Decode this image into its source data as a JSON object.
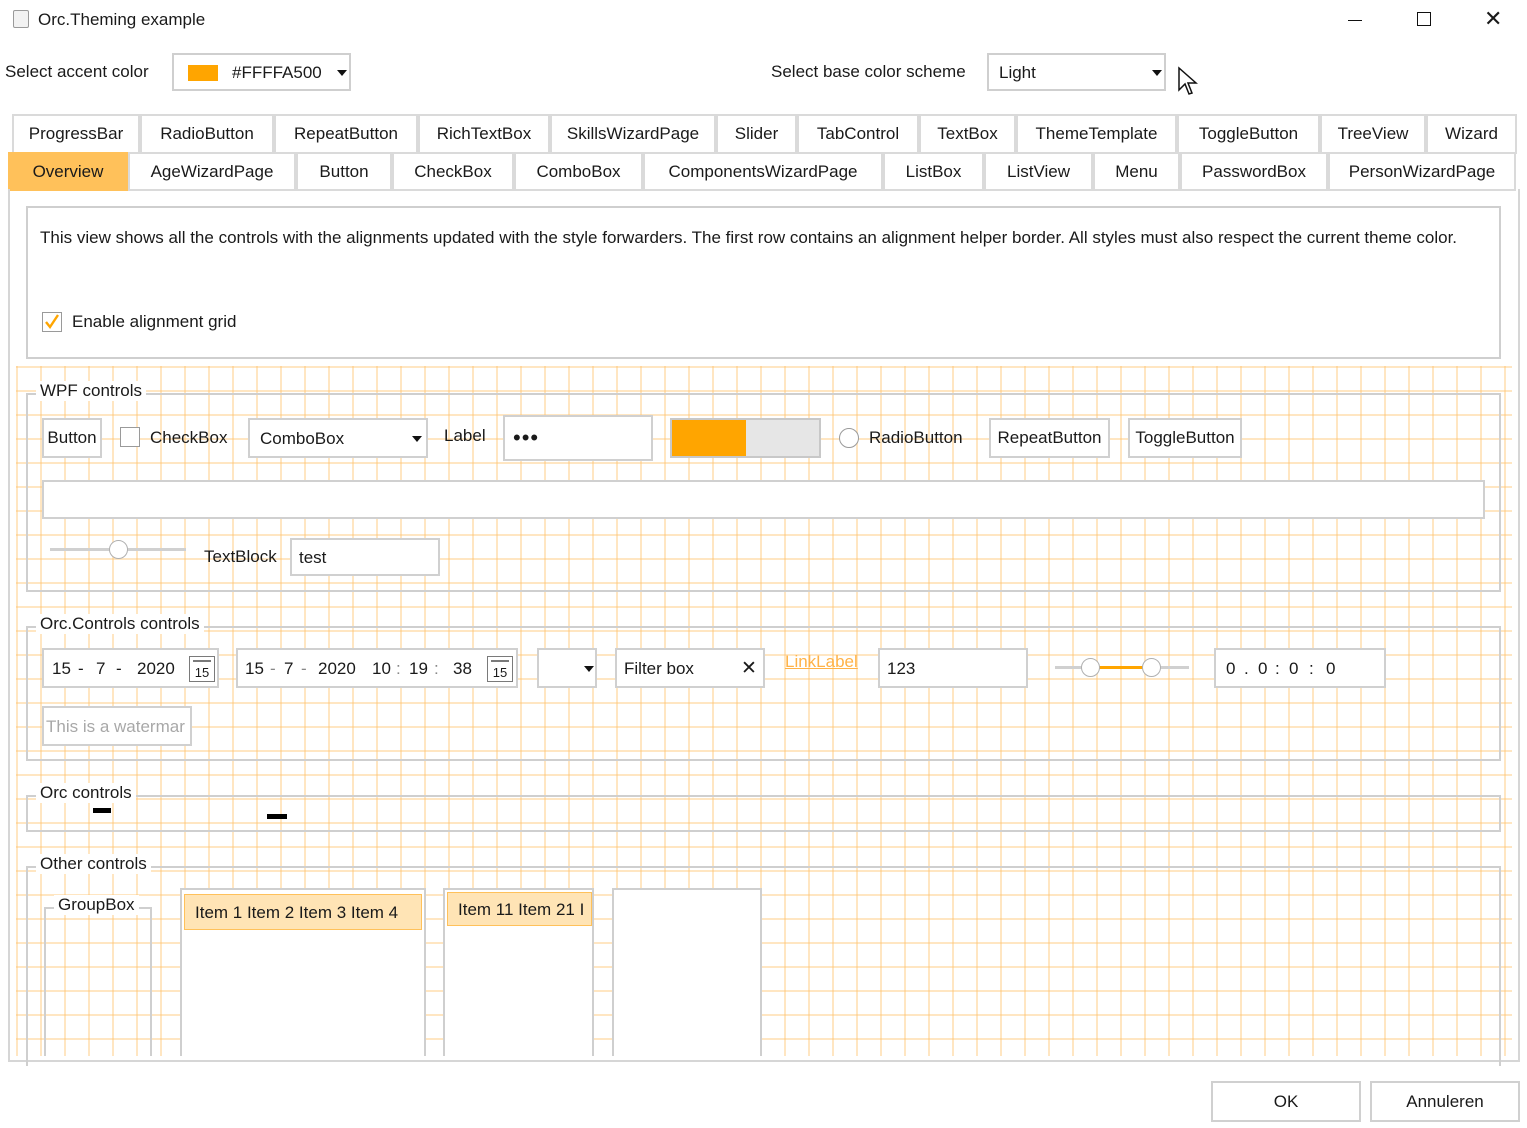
{
  "window": {
    "title": "Orc.Theming example"
  },
  "header": {
    "accent_label": "Select accent color",
    "accent_value": "#FFFFA500",
    "accent_color": "#FFA500",
    "scheme_label": "Select base color scheme",
    "scheme_value": "Light"
  },
  "tabs_row1": [
    "ProgressBar",
    "RadioButton",
    "RepeatButton",
    "RichTextBox",
    "SkillsWizardPage",
    "Slider",
    "TabControl",
    "TextBox",
    "ThemeTemplate",
    "ToggleButton",
    "TreeView",
    "Wizard"
  ],
  "tabs_row2": [
    "Overview",
    "AgeWizardPage",
    "Button",
    "CheckBox",
    "ComboBox",
    "ComponentsWizardPage",
    "ListBox",
    "ListView",
    "Menu",
    "PasswordBox",
    "PersonWizardPage"
  ],
  "selected_tab": "Overview",
  "intro": {
    "text": "This view shows all the controls with the alignments updated with the style forwarders. The first row contains an alignment helper border. All styles must also respect the current theme color.",
    "grid_checkbox_label": "Enable alignment grid",
    "grid_checked": true
  },
  "wpf": {
    "legend": "WPF controls",
    "button": "Button",
    "checkbox": "CheckBox",
    "combobox": "ComboBox",
    "label": "Label",
    "password": "•••",
    "progress": 0.5,
    "radio": "RadioButton",
    "repeat": "RepeatButton",
    "toggle": "ToggleButton",
    "slider_value": 0.5,
    "textblock": "TextBlock",
    "textbox": "test"
  },
  "orc_controls": {
    "legend": "Orc.Controls controls",
    "date": {
      "day": "15",
      "month": "7",
      "year": "2020",
      "cal": "15"
    },
    "datetime": {
      "day": "15",
      "month": "7",
      "year": "2020",
      "hour": "10",
      "minute": "19",
      "second": "38",
      "cal": "15"
    },
    "filter": "Filter box",
    "link": "LinkLabel",
    "numeric": "123",
    "range": {
      "low": 0.23,
      "high": 0.76
    },
    "timespan": {
      "d": "0",
      "h": "0",
      "m": "0",
      "s": "0"
    },
    "watermark": "This is a watermar"
  },
  "orc": {
    "legend": "Orc controls"
  },
  "other": {
    "legend": "Other controls",
    "groupbox": "GroupBox",
    "list1": "Item 1 Item 2 Item 3 Item 4",
    "list2": "Item 11 Item 21 I"
  },
  "footer": {
    "ok": "OK",
    "cancel": "Annuleren"
  }
}
